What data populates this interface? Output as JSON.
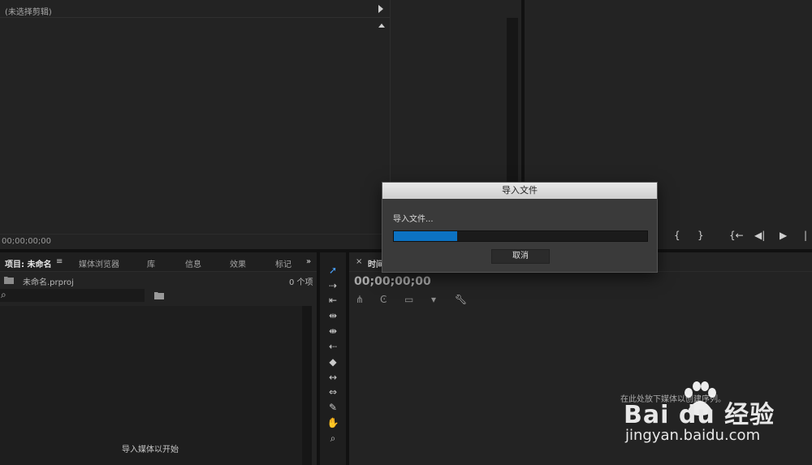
{
  "source_monitor": {
    "header": "(未选择剪辑)",
    "timecode": "00;00;00;00"
  },
  "project_panel": {
    "tabs": [
      "项目: 未命名",
      "媒体浏览器",
      "库",
      "信息",
      "效果",
      "标记"
    ],
    "menu_icon": "hamburger-icon",
    "overflow_icon": "double-chevron-right-icon",
    "file_name": "未命名.prproj",
    "item_count": "0 个项",
    "search_placeholder": "",
    "empty_message": "导入媒体以开始"
  },
  "timeline": {
    "tab_label": "时间",
    "timecode": "00;00;00;00",
    "drop_hint": "在此处放下媒体以创建序列。"
  },
  "dialog": {
    "title": "导入文件",
    "message": "导入文件...",
    "progress": 0.25,
    "cancel_label": "取消",
    "accent": "#0c72c2"
  },
  "watermark": {
    "logo": "Bai du 经验",
    "url": "jingyan.baidu.com"
  }
}
